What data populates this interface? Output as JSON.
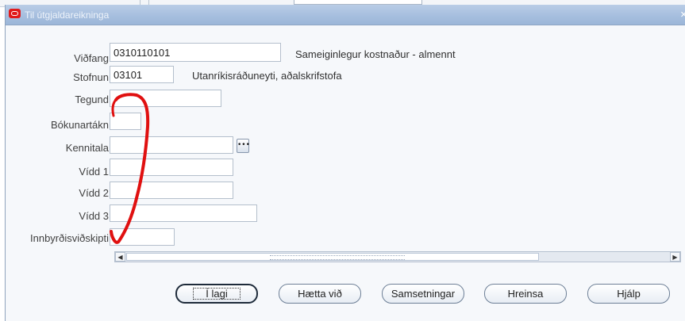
{
  "window": {
    "title": "Til útgjaldareikninga"
  },
  "fields": {
    "vidfang": {
      "label": "Viðfang",
      "value": "0310110101",
      "description": "Sameiginlegur kostnaður - almennt"
    },
    "stofnun": {
      "label": "Stofnun",
      "value": "03101",
      "description": "Utanríkisráðuneyti, aðalskrifstofa"
    },
    "tegund": {
      "label": "Tegund",
      "value": ""
    },
    "bokunartakn": {
      "label": "Bókunartákn",
      "value": ""
    },
    "kennitala": {
      "label": "Kennitala",
      "value": ""
    },
    "vidd1": {
      "label": "Vídd 1",
      "value": ""
    },
    "vidd2": {
      "label": "Vídd 2",
      "value": ""
    },
    "vidd3": {
      "label": "Vídd 3",
      "value": ""
    },
    "innbyrdis": {
      "label": "Innbyrðisviðskipti",
      "value": ""
    }
  },
  "buttons": {
    "ok": "Í lagi",
    "cancel": "Hætta við",
    "combinations": "Samsetningar",
    "clear": "Hreinsa",
    "help": "Hjálp"
  },
  "icons": {
    "app": "oracle-icon",
    "close": "close-icon",
    "lov": "list-of-values-icon",
    "scroll_left": "scroll-left-icon",
    "scroll_right": "scroll-right-icon"
  },
  "colors": {
    "title_bar": "#a5bede",
    "annotation": "#e01010",
    "oracle_red": "#e11b1b"
  }
}
